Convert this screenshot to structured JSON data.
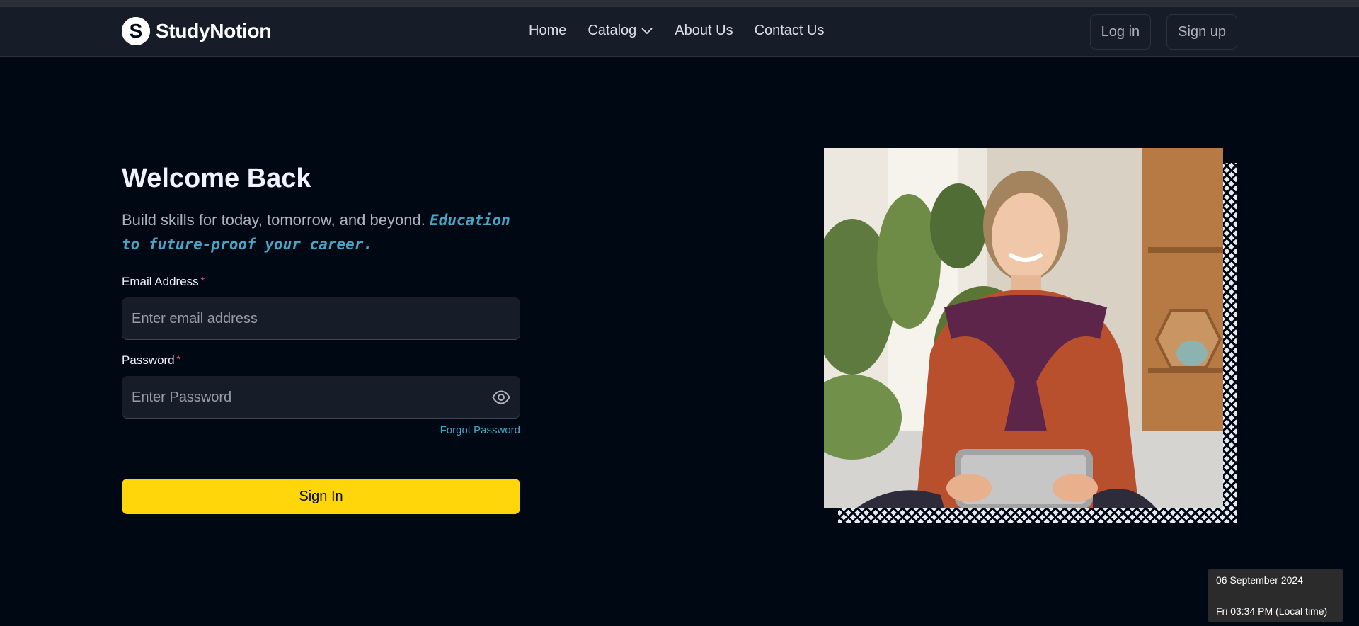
{
  "window": {
    "title": "StudyNotion"
  },
  "brand": {
    "name": "StudyNotion",
    "logo_letter": "S"
  },
  "nav": {
    "home": "Home",
    "catalog": "Catalog",
    "about": "About Us",
    "contact": "Contact Us"
  },
  "auth": {
    "login": "Log in",
    "signup": "Sign up"
  },
  "login": {
    "title": "Welcome Back",
    "subtitle": "Build skills for today, tomorrow, and beyond.",
    "subtitle_highlight": "Education to future-proof your career.",
    "email_label": "Email Address",
    "email_placeholder": "Enter email address",
    "password_label": "Password",
    "password_placeholder": "Enter Password",
    "required_marker": "*",
    "forgot_password": "Forgot Password",
    "submit": "Sign In"
  },
  "tooltip": {
    "date": "06 September 2024",
    "time": "Fri 03:34 PM (Local time)"
  },
  "icons": {
    "logo": "studynotion-logo-icon",
    "catalog_dropdown": "chevron-down-icon",
    "show_password": "eye-icon"
  },
  "colors": {
    "page_background": "#000814",
    "navbar_background": "#161D29",
    "accent_yellow": "#FFD60A",
    "highlight_blue": "#47A5C5",
    "required_red": "#EF476F"
  }
}
